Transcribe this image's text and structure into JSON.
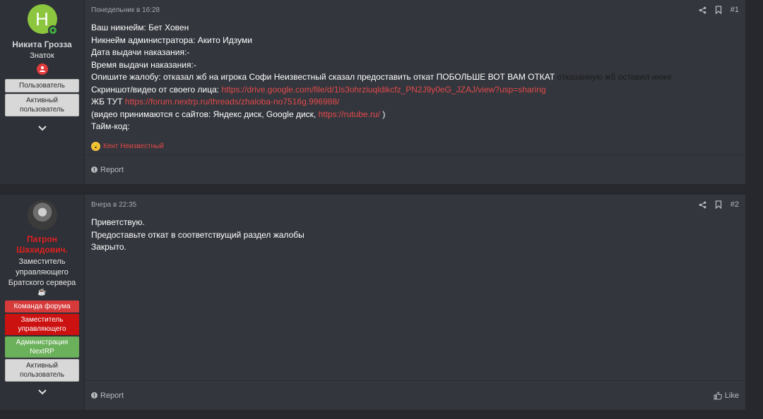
{
  "post1": {
    "user": {
      "avatar_letter": "H",
      "name": "Никита Грозза",
      "title": "Знаток",
      "banners": [
        "Пользователь",
        "Активный пользователь"
      ]
    },
    "date": "Понедельник в 16:28",
    "number": "#1",
    "lines": {
      "l1": "Ваш никнейм: Бет Ховен",
      "l2": "Никнейм администратора: Акито Идзуми",
      "l3": "Дата выдачи наказания:-",
      "l4": "Время выдачи наказания:-",
      "l5_text": "Опишите жалобу: отказал жб на игрока Софи Неизвестный сказал предоставить откат ПОБОЛЬШЕ ВОТ ВАМ ОТКАТ",
      "l5_dark": "отказанную жб оставил ниже",
      "l6_text": "Скриншот/видео от своего лица:",
      "l6_link": "https://drive.google.com/file/d/1ls3ohrziuqldikcfz_PN2J9y0eG_JZAJ/view?usp=sharing",
      "l7_text": "ЖБ ТУТ",
      "l7_link": "https://forum.nextrp.ru/threads/zhaloba-no7516g.996988/",
      "l8_text": "(видео принимаются с сайтов: Яндекс диск, Google диск,",
      "l8_link": "https://rutube.ru/",
      "l8_end": ")",
      "l9": "Тайм-код:"
    },
    "reaction": "Кент Неизвестный",
    "report": "Report"
  },
  "post2": {
    "user": {
      "name": "Патрон Шахидович.",
      "title": "Заместитель управляющего Братского сервера",
      "banners": [
        "Команда форума",
        "Заместитель управляющего",
        "Администрация NextRP",
        "Активный пользователь"
      ]
    },
    "date": "Вчера в 22:35",
    "number": "#2",
    "lines": {
      "l1": "Приветствую.",
      "l2": "Предоставьте откат в соответствущий раздел жалобы",
      "l3": "Закрыто."
    },
    "report": "Report",
    "like": "Like"
  },
  "colors": {
    "link": "#e34a4a",
    "background": "#26282d",
    "panel": "#33363d",
    "sidebar": "#2e3137"
  },
  "icons": [
    "online-status-icon",
    "user-badge-icon",
    "chevron-down-icon",
    "share-icon",
    "bookmark-icon",
    "report-icon",
    "like-icon",
    "emoji-icon"
  ]
}
